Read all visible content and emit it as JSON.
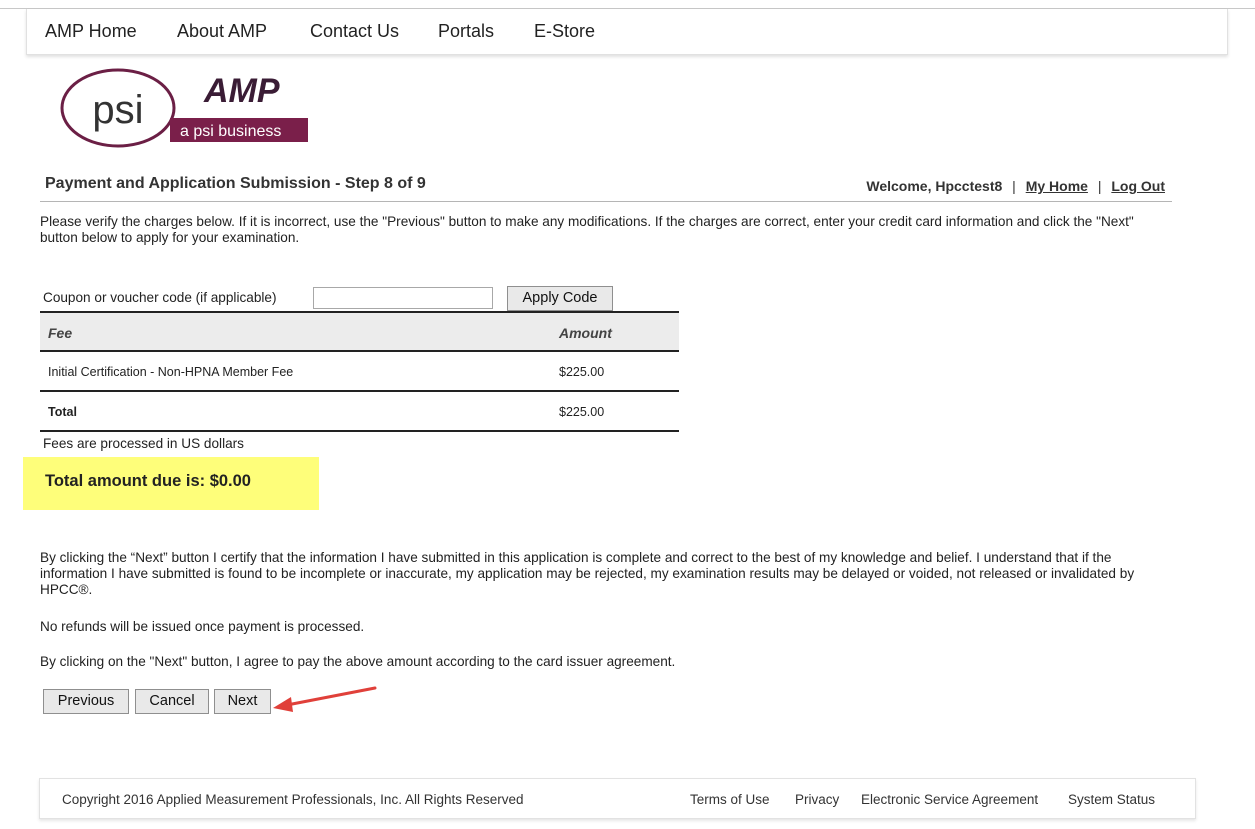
{
  "nav": {
    "items": [
      {
        "label": "AMP Home"
      },
      {
        "label": "About AMP"
      },
      {
        "label": "Contact Us"
      },
      {
        "label": "Portals"
      },
      {
        "label": "E-Store"
      }
    ]
  },
  "logo": {
    "psi_text": "psi",
    "amp_text": "AMP",
    "tagline": "a psi business"
  },
  "header": {
    "title": "Payment and Application Submission - Step 8 of 9",
    "welcome": "Welcome, Hpcctest8",
    "separator": "|",
    "my_home": "My Home",
    "log_out": "Log Out"
  },
  "intro": "Please verify the charges below. If it is incorrect, use the \"Previous\" button to make any modifications. If the charges are correct, enter your credit card information and click the \"Next\" button below to apply for your examination.",
  "coupon": {
    "label": "Coupon or voucher code (if applicable)",
    "value": "",
    "button": "Apply Code"
  },
  "fees": {
    "headers": {
      "fee": "Fee",
      "amount": "Amount"
    },
    "rows": [
      {
        "fee": "Initial Certification - Non-HPNA Member Fee",
        "amount": "$225.00"
      }
    ],
    "total": {
      "label": "Total",
      "amount": "$225.00"
    },
    "note": "Fees are processed in US dollars"
  },
  "due": {
    "text": "Total amount due is: $0.00",
    "highlight_color": "#fefe7a"
  },
  "certify": "By clicking the “Next” button I certify that the information I have submitted in this application is complete and correct to the best of my knowledge and belief. I understand that if the information I have submitted is found to be incomplete or inaccurate, my application may be rejected, my examination results may be delayed or voided, not released or invalidated by HPCC®.",
  "norefund": "No refunds will be issued once payment is processed.",
  "agree": "By clicking on the \"Next\" button, I agree to pay the above amount according to the card issuer agreement.",
  "buttons": {
    "previous": "Previous",
    "cancel": "Cancel",
    "next": "Next"
  },
  "annotation": {
    "arrow_color": "#e0403a",
    "icon": "arrow-icon"
  },
  "footer": {
    "copyright": "Copyright 2016 Applied Measurement Professionals, Inc. All Rights Reserved",
    "links": [
      {
        "label": "Terms of Use"
      },
      {
        "label": "Privacy"
      },
      {
        "label": "Electronic Service Agreement"
      },
      {
        "label": "System Status"
      }
    ]
  }
}
